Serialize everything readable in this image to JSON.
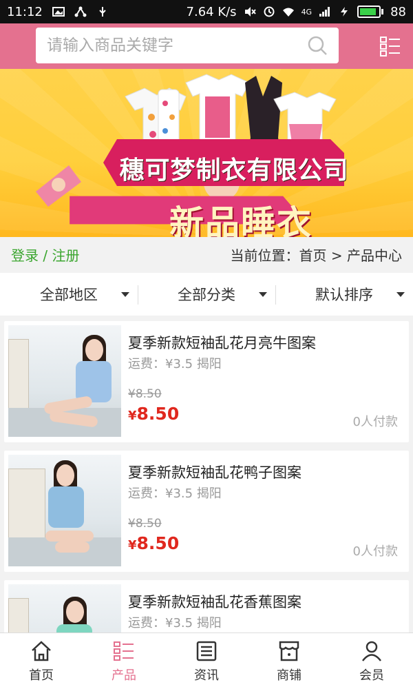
{
  "status_bar": {
    "time": "11:12",
    "speed": "7.64 K/s",
    "network": "4G",
    "battery": "88"
  },
  "search": {
    "placeholder": "请输入商品关键字"
  },
  "banner": {
    "company": "穗可梦制衣有限公司",
    "slogan": "新品睡衣"
  },
  "location_bar": {
    "login_text": "登录 / 注册",
    "location_text": "当前位置：首页 > 产品中心"
  },
  "filters": [
    {
      "label": "全部地区"
    },
    {
      "label": "全部分类"
    },
    {
      "label": "默认排序"
    }
  ],
  "products": [
    {
      "title": "夏季新款短袖乱花月亮牛图案",
      "shipping": "运费：¥3.5 揭阳",
      "old_price": "¥8.50",
      "price_symbol": "¥",
      "price": "8.50",
      "sold": "0人付款"
    },
    {
      "title": "夏季新款短袖乱花鸭子图案",
      "shipping": "运费：¥3.5 揭阳",
      "old_price": "¥8.50",
      "price_symbol": "¥",
      "price": "8.50",
      "sold": "0人付款"
    },
    {
      "title": "夏季新款短袖乱花香蕉图案",
      "shipping": "运费：¥3.5 揭阳",
      "old_price": "",
      "price_symbol": "",
      "price": "",
      "sold": ""
    }
  ],
  "tabs": [
    {
      "label": "首页",
      "icon": "home-icon"
    },
    {
      "label": "产品",
      "icon": "list-icon"
    },
    {
      "label": "资讯",
      "icon": "news-icon"
    },
    {
      "label": "商铺",
      "icon": "store-icon"
    },
    {
      "label": "会员",
      "icon": "user-icon"
    }
  ],
  "colors": {
    "header": "#e4718f",
    "active_tab": "#e4718f",
    "price": "#e0281e",
    "login": "#3aa52e",
    "banner": "#ffcf3b"
  }
}
